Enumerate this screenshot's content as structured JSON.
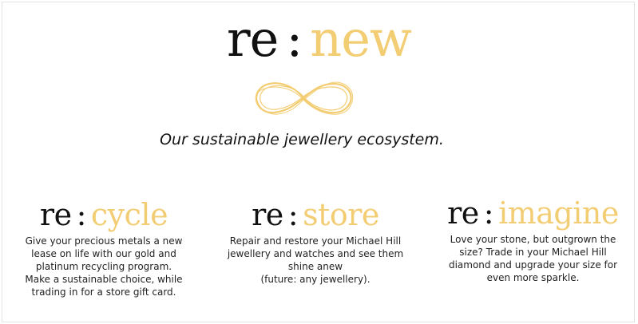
{
  "colors": {
    "dark": "#111111",
    "gold": "#f3cd73"
  },
  "hero": {
    "prefix": "re",
    "colon": ":",
    "word": "new",
    "icon": "infinity-icon",
    "tagline": "Our sustainable jewellery ecosystem."
  },
  "columns": [
    {
      "prefix": "re",
      "colon": ":",
      "word": "cycle",
      "lines": [
        "Give your precious metals a new",
        "lease on life with our gold and",
        "platinum recycling program.",
        "Make a sustainable choice, while",
        "trading in for a store gift card."
      ]
    },
    {
      "prefix": "re",
      "colon": ":",
      "word": "store",
      "lines": [
        "Repair and restore your Michael Hill",
        "jewellery and watches and see them",
        "shine anew",
        "(future: any jewellery)."
      ]
    },
    {
      "prefix": "re",
      "colon": ":",
      "word": "imagine",
      "lines": [
        "Love your stone, but outgrown the",
        "size? Trade in your Michael Hill",
        "diamond and upgrade your size for",
        "even more sparkle."
      ]
    }
  ]
}
